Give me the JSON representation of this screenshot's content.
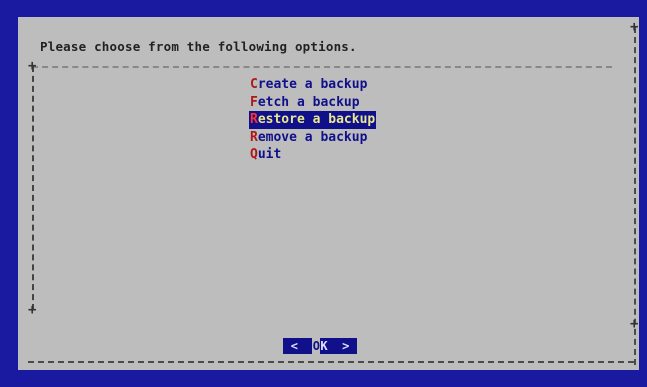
{
  "dialog": {
    "title": "Please choose from the following options."
  },
  "menu": {
    "items": [
      {
        "hotkey": "C",
        "rest": "reate a backup",
        "selected": false
      },
      {
        "hotkey": "F",
        "rest": "etch a backup",
        "selected": false
      },
      {
        "hotkey": "R",
        "rest": "estore a backup",
        "selected": true
      },
      {
        "hotkey": "R",
        "rest": "emove a backup",
        "selected": false
      },
      {
        "hotkey": "Q",
        "rest": "uit",
        "selected": false
      }
    ]
  },
  "buttons": {
    "ok": {
      "left_bracket": "<",
      "cursor": "O",
      "label": "K",
      "right_bracket": ">"
    }
  },
  "colors": {
    "background": "#1a1aa0",
    "dialog": "#bdbdbd",
    "menu_text": "#10108a",
    "hotkey": "#b01818",
    "selection_bg": "#10108a",
    "selection_fg": "#e8e890"
  }
}
